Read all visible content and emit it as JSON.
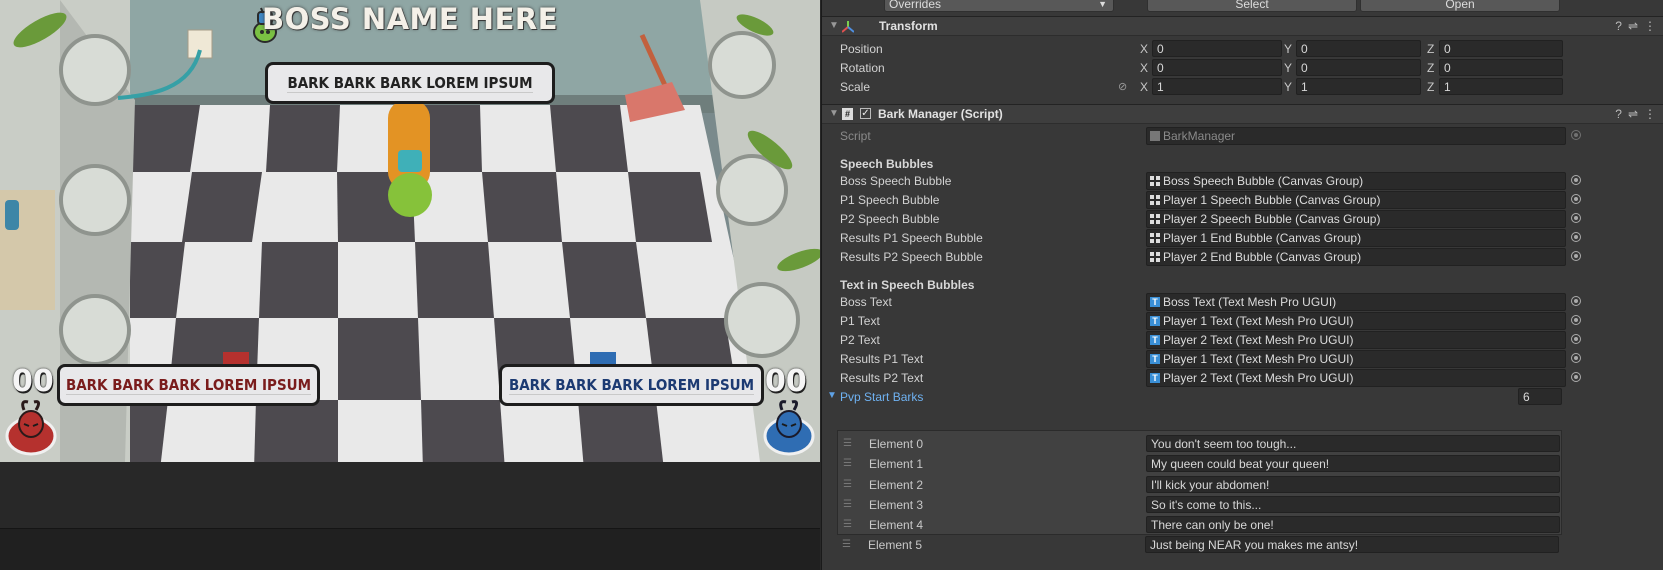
{
  "game_view": {
    "boss_name": "BOSS NAME HERE",
    "boss_bark": "BARK BARK BARK LOREM IPSUM",
    "p1_bark": "BARK BARK BARK LOREM IPSUM",
    "p2_bark": "BARK BARK BARK LOREM IPSUM",
    "p1_score": "00",
    "p2_score": "00",
    "colors": {
      "p1": "#b5312e",
      "p2": "#2f6db3",
      "boss": "#7ac043"
    }
  },
  "inspector": {
    "overrides_label": "Overrides",
    "select_label": "Select",
    "open_label": "Open",
    "transform": {
      "title": "Transform",
      "position": {
        "label": "Position",
        "x": "0",
        "y": "0",
        "z": "0"
      },
      "rotation": {
        "label": "Rotation",
        "x": "0",
        "y": "0",
        "z": "0"
      },
      "scale": {
        "label": "Scale",
        "x": "1",
        "y": "1",
        "z": "1"
      },
      "axis_x": "X",
      "axis_y": "Y",
      "axis_z": "Z"
    },
    "bark_manager": {
      "title": "Bark Manager (Script)",
      "script_label": "Script",
      "script_value": "BarkManager",
      "speech_bubbles_header": "Speech Bubbles",
      "bubbles": [
        {
          "label": "Boss Speech Bubble",
          "value": "Boss Speech Bubble (Canvas Group)"
        },
        {
          "label": "P1 Speech Bubble",
          "value": "Player 1 Speech Bubble (Canvas Group)"
        },
        {
          "label": "P2 Speech Bubble",
          "value": "Player 2 Speech Bubble (Canvas Group)"
        },
        {
          "label": "Results P1 Speech Bubble",
          "value": "Player 1 End Bubble (Canvas Group)"
        },
        {
          "label": "Results P2 Speech Bubble",
          "value": "Player 2 End Bubble (Canvas Group)"
        }
      ],
      "text_header": "Text in Speech Bubbles",
      "texts": [
        {
          "label": "Boss Text",
          "value": "Boss Text (Text Mesh Pro UGUI)"
        },
        {
          "label": "P1 Text",
          "value": "Player 1 Text (Text Mesh Pro UGUI)"
        },
        {
          "label": "P2 Text",
          "value": "Player 2 Text (Text Mesh Pro UGUI)"
        },
        {
          "label": "Results P1 Text",
          "value": "Player 1 Text (Text Mesh Pro UGUI)"
        },
        {
          "label": "Results P2 Text",
          "value": "Player 2 Text (Text Mesh Pro UGUI)"
        }
      ],
      "pvp": {
        "label": "Pvp Start Barks",
        "count": "6",
        "elements": [
          {
            "label": "Element 0",
            "value": "You don't seem too tough..."
          },
          {
            "label": "Element 1",
            "value": "My queen could beat your queen!"
          },
          {
            "label": "Element 2",
            "value": "I'll kick your abdomen!"
          },
          {
            "label": "Element 3",
            "value": "So it's come to this..."
          },
          {
            "label": "Element 4",
            "value": "There can only be one!"
          },
          {
            "label": "Element 5",
            "value": "Just being NEAR you makes me antsy!"
          }
        ]
      }
    }
  }
}
